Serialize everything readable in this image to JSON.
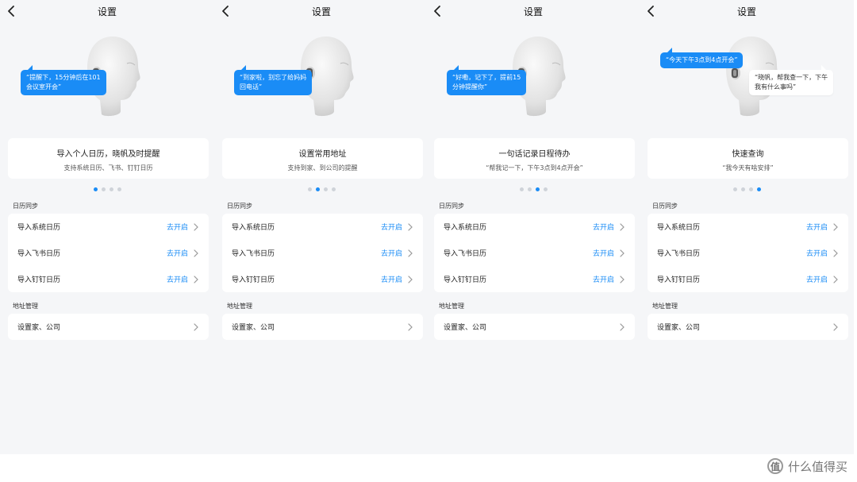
{
  "screens": [
    {
      "title": "设置",
      "bubbles": [
        {
          "style": "blue",
          "text": "“提醒下，15分钟后在101\n会议室开会”"
        }
      ],
      "feature": {
        "title": "导入个人日历，晓帆及时提醒",
        "subtitle": "支持系统日历、飞书、钉钉日历"
      },
      "active_dot": 0,
      "calendar_section": "日历同步",
      "calendar_rows": [
        {
          "label": "导入系统日历",
          "action": "去开启"
        },
        {
          "label": "导入飞书日历",
          "action": "去开启"
        },
        {
          "label": "导入钉钉日历",
          "action": "去开启"
        }
      ],
      "address_section": "地址管理",
      "address_row": "设置家、公司"
    },
    {
      "title": "设置",
      "bubbles": [
        {
          "style": "blue",
          "text": "“到家啦，别忘了给妈妈\n回电话”"
        }
      ],
      "feature": {
        "title": "设置常用地址",
        "subtitle": "支持到家、到公司的提醒"
      },
      "active_dot": 1,
      "calendar_section": "日历同步",
      "calendar_rows": [
        {
          "label": "导入系统日历",
          "action": "去开启"
        },
        {
          "label": "导入飞书日历",
          "action": "去开启"
        },
        {
          "label": "导入钉钉日历",
          "action": "去开启"
        }
      ],
      "address_section": "地址管理",
      "address_row": "设置家、公司"
    },
    {
      "title": "设置",
      "bubbles": [
        {
          "style": "blue",
          "text": "“好嘞，记下了，提前15\n分钟提醒你”"
        }
      ],
      "feature": {
        "title": "一句话记录日程待办",
        "subtitle": "“帮我记一下，下午3点到4点开会”"
      },
      "active_dot": 2,
      "calendar_section": "日历同步",
      "calendar_rows": [
        {
          "label": "导入系统日历",
          "action": "去开启"
        },
        {
          "label": "导入飞书日历",
          "action": "去开启"
        },
        {
          "label": "导入钉钉日历",
          "action": "去开启"
        }
      ],
      "address_section": "地址管理",
      "address_row": "设置家、公司"
    },
    {
      "title": "设置",
      "bubbles": [
        {
          "style": "blue",
          "text": "“今天下午3点到4点开会”"
        },
        {
          "style": "white",
          "text": "“晓帆，帮我查一下，下午\n我有什么事吗”"
        }
      ],
      "feature": {
        "title": "快速查询",
        "subtitle": "“我今天有啥安排”"
      },
      "active_dot": 3,
      "calendar_section": "日历同步",
      "calendar_rows": [
        {
          "label": "导入系统日历",
          "action": "去开启"
        },
        {
          "label": "导入飞书日历",
          "action": "去开启"
        },
        {
          "label": "导入钉钉日历",
          "action": "去开启"
        }
      ],
      "address_section": "地址管理",
      "address_row": "设置家、公司"
    }
  ],
  "dot_count": 4,
  "colors": {
    "accent": "#1a8cf6",
    "background": "#f5f6f8",
    "card": "#ffffff",
    "dot_inactive": "#cfd3d9"
  },
  "icons": {
    "back": "chevron-left-icon",
    "row_arrow": "chevron-right-icon",
    "avatar": "head-illustration"
  },
  "watermark": {
    "logo": "值",
    "text": "什么值得买"
  }
}
